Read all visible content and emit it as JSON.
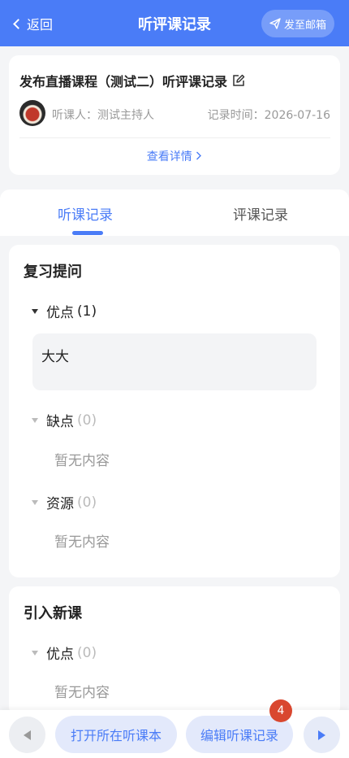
{
  "navbar": {
    "back_label": "返回",
    "title": "听评课记录",
    "mail_label": "发至邮箱"
  },
  "course": {
    "title": "发布直播课程（测试二）听评课记录",
    "listener": "听课人：测试主持人",
    "record_time": "记录时间：2026-07-16",
    "detail_link": "查看详情"
  },
  "tabs": [
    {
      "label": "听课记录",
      "active": true
    },
    {
      "label": "评课记录",
      "active": false
    }
  ],
  "sections": [
    {
      "title": "复习提问",
      "items": [
        {
          "label": "优点",
          "count": "(1)",
          "expanded": true,
          "content": "大大"
        },
        {
          "label": "缺点",
          "count": "(0)",
          "empty_text": "暂无内容"
        },
        {
          "label": "资源",
          "count": "(0)",
          "empty_text": "暂无内容"
        }
      ]
    },
    {
      "title": "引入新课",
      "items": [
        {
          "label": "优点",
          "count": "(0)",
          "empty_text": "暂无内容"
        }
      ]
    }
  ],
  "bottom_bar": {
    "open_notebook_label": "打开所在听课本",
    "edit_record_label": "编辑听课记录",
    "badge_count": "4"
  },
  "colors": {
    "accent": "#4a7cf7",
    "badge": "#d9472f"
  },
  "icons": [
    "chevron-left-icon",
    "send-icon",
    "edit-icon",
    "chevron-right-icon",
    "triangle-down-icon",
    "prev-icon",
    "next-icon"
  ]
}
